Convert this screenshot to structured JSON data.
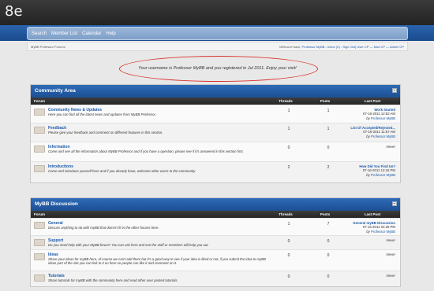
{
  "site": {
    "logo": "8e"
  },
  "nav": [
    "Search",
    "Member List",
    "Calendar",
    "Help"
  ],
  "subbar": {
    "left": "MyBB Professor Forums",
    "welcome_prefix": "Welcome back, ",
    "username": "Professor MyBB",
    "links": " - Inbox (0) - Sign Out) User CP — Mod CP — Admin CP"
  },
  "welcome_msg": "Your username is Professor MyBB and you registered in Jul 2011.  Enjoy your visit!",
  "columns": {
    "forum": "Forum",
    "threads": "Threads",
    "posts": "Posts",
    "last_post": "Last Post"
  },
  "categories": [
    {
      "title": "Community Area",
      "collapse": "−",
      "forums": [
        {
          "name": "Community News & Updates",
          "desc": "Here you can find all the latest news and updates from MyBB Professor.",
          "threads": "1",
          "posts": "1",
          "last_title": "Work Started",
          "last_date": "07-16-2011 12:52 AM",
          "by": "by ",
          "last_user": "Professor MyBB"
        },
        {
          "name": "Feedback",
          "desc": "Please give your feedback and comment on different features in this section.",
          "threads": "1",
          "posts": "1",
          "last_title": "List Of Accepted/Rejected...",
          "last_date": "07-16-2011 11:57 AM",
          "by": "by ",
          "last_user": "Professor MyBB"
        },
        {
          "name": "Information",
          "desc": "Come and see all the information about MyBB Professor and if you have a question, please see if it's answered in this section first.",
          "threads": "0",
          "posts": "0",
          "last_title": "",
          "last_date": "Never",
          "by": "",
          "last_user": ""
        },
        {
          "name": "Introductions",
          "desc": "Come and introduce yourself here and if you already have, welcome other users to the community.",
          "threads": "2",
          "posts": "2",
          "last_title": "How Did You Find Us?",
          "last_date": "07-16-2011 12:15 PM",
          "by": "by ",
          "last_user": "Professor MyBB"
        }
      ]
    },
    {
      "title": "MyBB Discussion",
      "collapse": "−",
      "forums": [
        {
          "name": "General",
          "desc": "Discuss anything to do with myBB that doesn't fit in the other forums here.",
          "threads": "1",
          "posts": "7",
          "last_title": "General myBB Discussion",
          "last_date": "07-16-2011 04:26 PM",
          "by": "by ",
          "last_user": "Professor MyBB"
        },
        {
          "name": "Support",
          "desc": "Do you need help with your MyBB forum? You can ask here and see the staff or members will help you out.",
          "threads": "0",
          "posts": "0",
          "last_title": "",
          "last_date": "Never",
          "by": "",
          "last_user": ""
        },
        {
          "name": "Ideas",
          "desc": "Share your ideas for myBB here, of course we can't add them but it's a good way to see if your idea is liked or not, if you submit the idea to myBB ideas part of the site you can link to it on here so people can like it and comment on it.",
          "threads": "0",
          "posts": "0",
          "last_title": "",
          "last_date": "Never",
          "by": "",
          "last_user": ""
        },
        {
          "name": "Tutorials",
          "desc": "Share tutorials for myBB with the community here and read other user posted tutorials.",
          "threads": "0",
          "posts": "0",
          "last_title": "",
          "last_date": "Never",
          "by": "",
          "last_user": ""
        }
      ]
    }
  ]
}
